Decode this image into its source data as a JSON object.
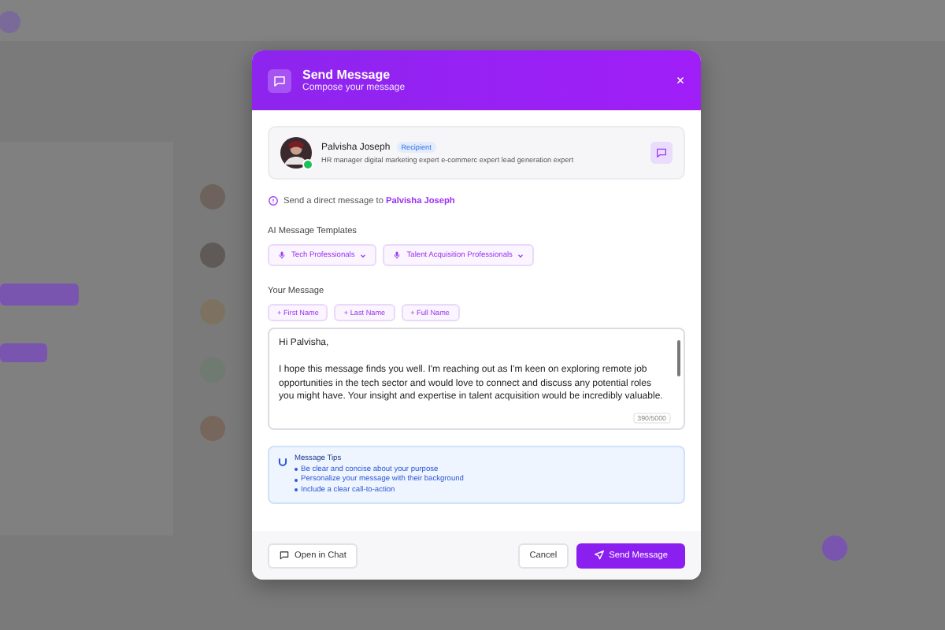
{
  "dialog": {
    "title": "Send Message",
    "subtitle": "Compose your message"
  },
  "recipient": {
    "name": "Palvisha Joseph",
    "badge": "Recipient",
    "headline": "HR manager digital marketing expert e-commerc expert lead generation expert",
    "online": true
  },
  "info": {
    "text": "Send a direct message to **Palvisha Joseph**"
  },
  "templates": {
    "label": "AI Message Templates",
    "items": [
      {
        "label": "Tech Professionals"
      },
      {
        "label": "Talent Acquisition Professionals"
      }
    ]
  },
  "message": {
    "label": "Your Message",
    "variables": [
      "+ First Name",
      "+ Last Name",
      "+ Full Name"
    ],
    "value": "Hi Palvisha,\n\nI hope this message finds you well. I'm reaching out as I'm keen on exploring remote job opportunities in the tech sector and would love to connect and discuss any potential roles you might have. Your insight and expertise in talent acquisition would be incredibly valuable.",
    "counter": "390/5000"
  },
  "tips": {
    "title": "Message Tips",
    "items": [
      "Be clear and concise about your purpose",
      "Personalize your message with their background",
      "Include a clear call-to-action"
    ]
  },
  "footer": {
    "open_chat": "Open in Chat",
    "cancel": "Cancel",
    "send": "Send Message"
  }
}
